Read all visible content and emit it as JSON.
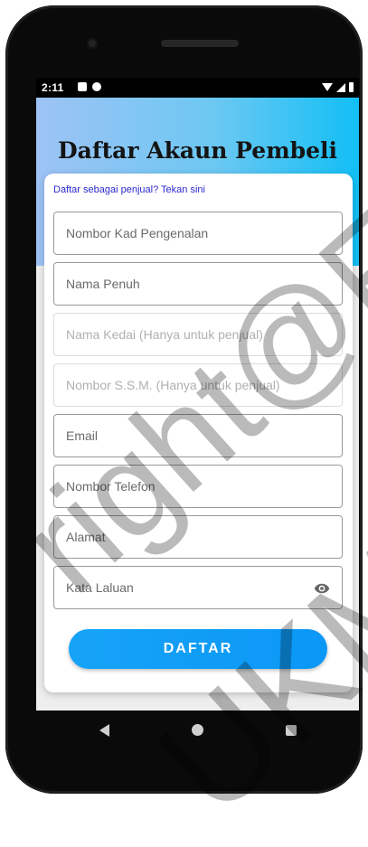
{
  "status_bar": {
    "time": "2:11"
  },
  "header": {
    "title": "Daftar Akaun Pembeli"
  },
  "form": {
    "seller_link": "Daftar sebagai penjual? Tekan sini",
    "fields": [
      {
        "placeholder": "Nombor Kad Pengenalan",
        "value": "",
        "enabled": true
      },
      {
        "placeholder": "Nama Penuh",
        "value": "",
        "enabled": true
      },
      {
        "placeholder": "Nama Kedai (Hanya untuk penjual)",
        "value": "",
        "enabled": false
      },
      {
        "placeholder": "Nombor S.S.M. (Hanya untuk penjual)",
        "value": "",
        "enabled": false
      },
      {
        "placeholder": "Email",
        "value": "",
        "enabled": true
      },
      {
        "placeholder": "Nombor Telefon",
        "value": "",
        "enabled": true
      },
      {
        "placeholder": "Alamat",
        "value": "",
        "enabled": true
      },
      {
        "placeholder": "Kata Laluan",
        "value": "",
        "enabled": true,
        "icon": "eye-icon"
      }
    ],
    "submit_label": "DAFTAR"
  },
  "watermark": {
    "line1": "right@F",
    "line2": "UKM"
  },
  "colors": {
    "header_gradient_start": "#9ec3f5",
    "header_gradient_end": "#12bff5",
    "button": "#0b97f6",
    "link": "#2a2ad0"
  }
}
